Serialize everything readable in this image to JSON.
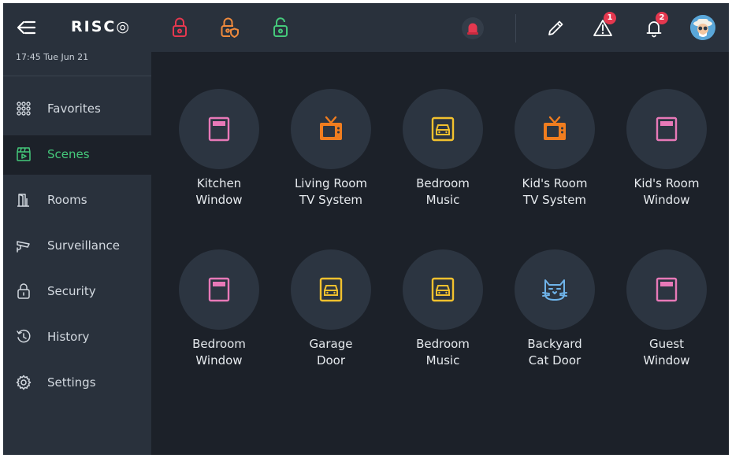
{
  "app": {
    "logo": "RISC◎",
    "datetime": "17:45 Tue Jun 21"
  },
  "sidebar": {
    "items": [
      {
        "label": "Favorites",
        "icon": "grid-icon"
      },
      {
        "label": "Scenes",
        "icon": "clapperboard-icon",
        "active": true
      },
      {
        "label": "Rooms",
        "icon": "door-icon"
      },
      {
        "label": "Surveillance",
        "icon": "camera-icon"
      },
      {
        "label": "Security",
        "icon": "lock-icon"
      },
      {
        "label": "History",
        "icon": "history-icon"
      },
      {
        "label": "Settings",
        "icon": "gear-icon"
      }
    ]
  },
  "topbar": {
    "lock_states": [
      "locked",
      "locked-partial",
      "unlocked"
    ],
    "lock_colors": [
      "#e5384f",
      "#f08a3c",
      "#45c97b"
    ],
    "warning_badge": "1",
    "notification_badge": "2"
  },
  "scenes": [
    {
      "line1": "Kitchen",
      "line2": "Window",
      "icon": "window-icon",
      "color": "#e879b8"
    },
    {
      "line1": "Living Room",
      "line2": "TV System",
      "icon": "tv-icon",
      "color": "#f07d1f"
    },
    {
      "line1": "Bedroom",
      "line2": "Music",
      "icon": "garage-icon",
      "color": "#f2c12e"
    },
    {
      "line1": "Kid's Room",
      "line2": "TV System",
      "icon": "tv-icon",
      "color": "#f07d1f"
    },
    {
      "line1": "Kid's Room",
      "line2": "Window",
      "icon": "window-icon",
      "color": "#e879b8"
    },
    {
      "line1": "Bedroom",
      "line2": "Window",
      "icon": "window-icon",
      "color": "#e879b8"
    },
    {
      "line1": "Garage",
      "line2": "Door",
      "icon": "garage-icon",
      "color": "#f2c12e"
    },
    {
      "line1": "Bedroom",
      "line2": "Music",
      "icon": "garage-icon",
      "color": "#f2c12e"
    },
    {
      "line1": "Backyard",
      "line2": "Cat Door",
      "icon": "cat-icon",
      "color": "#6fb4ea"
    },
    {
      "line1": "Guest",
      "line2": "Window",
      "icon": "window-icon",
      "color": "#e879b8"
    }
  ]
}
